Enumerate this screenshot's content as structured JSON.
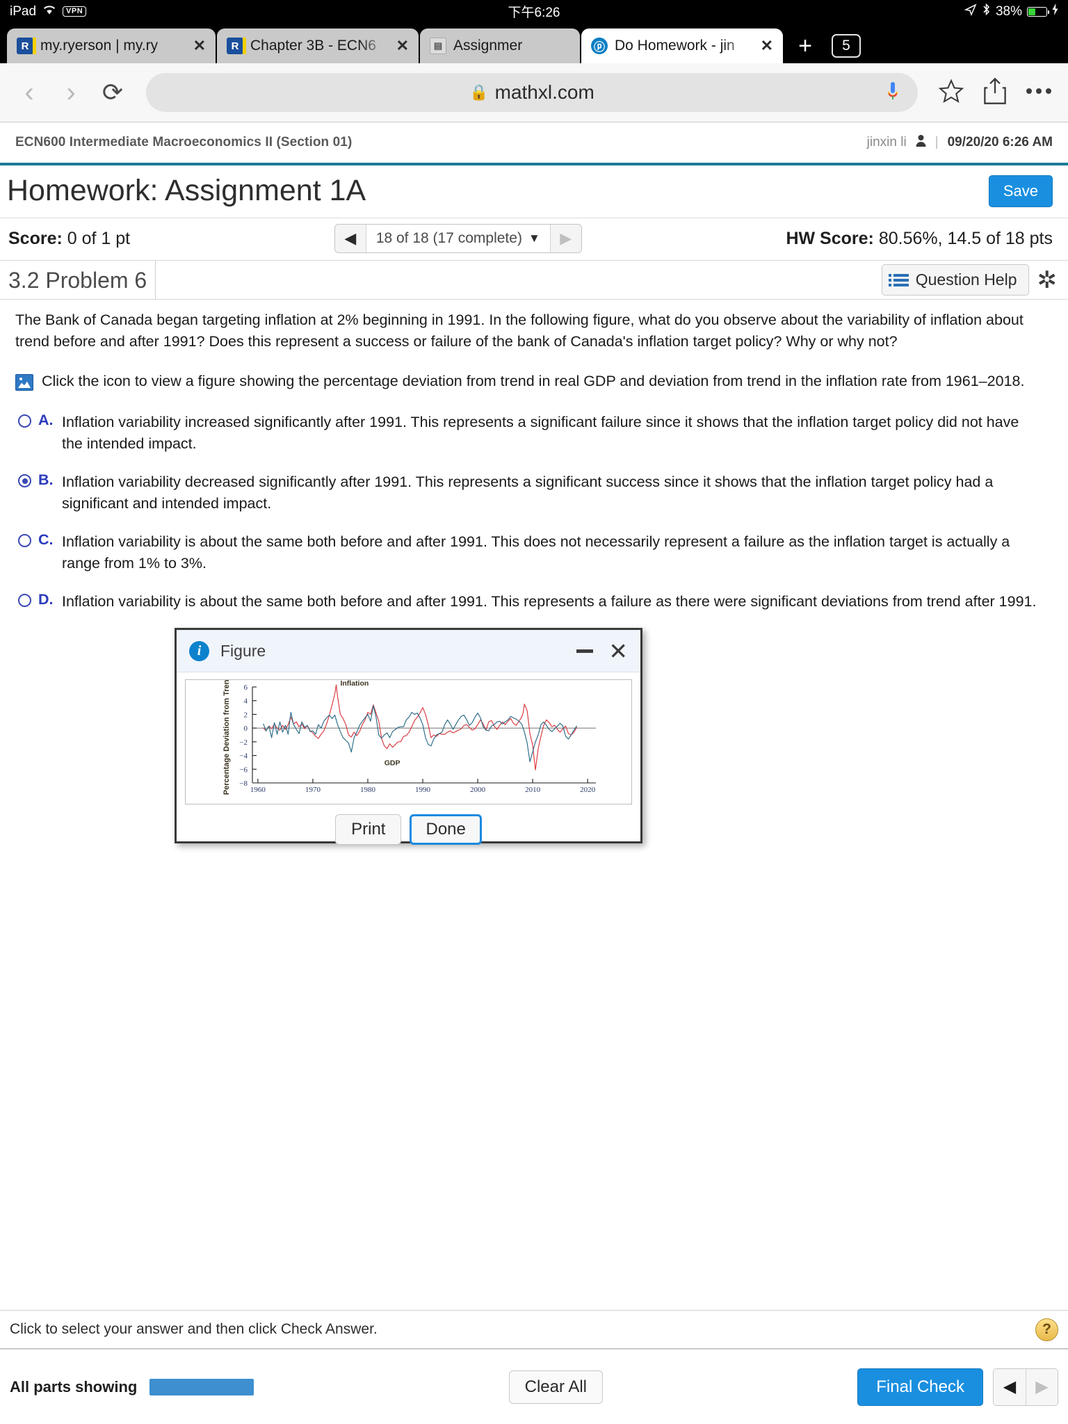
{
  "status_bar": {
    "device": "iPad",
    "wifi_icon": "wifi-icon",
    "vpn_label": "VPN",
    "time": "下午6:26",
    "location_icon": "location-arrow-icon",
    "bluetooth_icon": "bluetooth-icon",
    "battery_percent": "38%",
    "charging_icon": "lightning-bolt-icon"
  },
  "browser": {
    "tabs": [
      {
        "title": "my.ryerson | my.ry",
        "favicon": "pearson-r-icon",
        "active": false
      },
      {
        "title": "Chapter 3B - ECN6",
        "favicon": "pearson-r-icon",
        "active": false
      },
      {
        "title": "Assignmer",
        "favicon": "document-icon",
        "active": false
      },
      {
        "title": "Do Homework - jin",
        "favicon": "pearson-p-icon",
        "active": true
      }
    ],
    "new_tab_label": "+",
    "tab_count": "5",
    "back_icon": "chevron-left-icon",
    "forward_icon": "chevron-right-icon",
    "reload_icon": "reload-icon",
    "lock_icon": "lock-icon",
    "url": "mathxl.com",
    "mic_icon": "google-mic-icon",
    "bookmark_icon": "star-icon",
    "share_icon": "share-icon",
    "more_icon": "ellipsis-icon"
  },
  "mathxl_header": {
    "course": "ECN600 Intermediate Macroeconomics II (Section 01)",
    "user": "jinxin li",
    "user_icon": "person-icon",
    "separator": "|",
    "datetime": "09/20/20 6:26 AM"
  },
  "title_row": {
    "title": "Homework: Assignment 1A",
    "save_label": "Save"
  },
  "score_row": {
    "score_label": "Score:",
    "score_value": "0 of 1 pt",
    "prev_icon": "prev-arrow-icon",
    "next_icon": "next-arrow-icon",
    "pager_text": "18 of 18 (17 complete)",
    "pager_caret": "▼",
    "hw_label": "HW Score:",
    "hw_value": "80.56%, 14.5 of 18 pts"
  },
  "problem_bar": {
    "problem_label": "3.2 Problem 6",
    "question_help_label": "Question Help",
    "question_help_icon": "list-icon",
    "gear_icon": "gear-icon"
  },
  "question": {
    "prompt": "The Bank of Canada began targeting inflation at 2% beginning in 1991. In the following figure, what do you observe about the variability of inflation about trend before and after 1991? Does this represent a success or failure of the bank of Canada's inflation target policy? Why or why not?",
    "figure_link_icon": "image-icon",
    "figure_link_text": "Click the icon to view a figure showing the percentage deviation from trend in real GDP and deviation from trend in the inflation rate from 1961–2018.",
    "options": [
      {
        "letter": "A.",
        "selected": false,
        "text": "Inflation variability increased significantly after 1991. This represents a significant failure since it shows that the inflation target policy did not have the intended impact."
      },
      {
        "letter": "B.",
        "selected": true,
        "text": "Inflation variability decreased significantly after 1991. This represents a significant success since it shows that the inflation target policy had a significant and intended impact."
      },
      {
        "letter": "C.",
        "selected": false,
        "text": "Inflation variability is about the same both before and after 1991. This does not necessarily represent a failure as the inflation target is actually a range from 1% to 3%."
      },
      {
        "letter": "D.",
        "selected": false,
        "text": "Inflation variability is about the same both before and after 1991. This represents a failure as there were significant deviations from trend after 1991."
      }
    ]
  },
  "dialog": {
    "info_icon": "info-icon",
    "title": "Figure",
    "minimize_icon": "minimize-icon",
    "close_icon": "close-icon",
    "print_label": "Print",
    "done_label": "Done"
  },
  "chart_data": {
    "type": "line",
    "title": "",
    "xlabel": "",
    "ylabel": "Percentage Deviation from Trend",
    "xlim": [
      1961,
      2018
    ],
    "ylim": [
      -8,
      6
    ],
    "yticks": [
      -8,
      -6,
      -4,
      -2,
      0,
      2,
      4,
      6
    ],
    "xticks": [
      1960,
      1970,
      1980,
      1990,
      2000,
      2010,
      2020
    ],
    "grid": false,
    "legend_position": "inline-annotations",
    "annotations": [
      {
        "label": "Inflation",
        "x": 1975,
        "y": 6.2
      },
      {
        "label": "GDP",
        "x": 1983,
        "y": -5.4
      }
    ],
    "series": [
      {
        "name": "Inflation",
        "color": "#d8383f",
        "x": [
          1961,
          1961.5,
          1962,
          1962.5,
          1963,
          1963.5,
          1964,
          1964.5,
          1965,
          1965.5,
          1966,
          1966.5,
          1967,
          1967.5,
          1968,
          1968.5,
          1969,
          1969.5,
          1970,
          1970.5,
          1971,
          1971.5,
          1972,
          1972.5,
          1973,
          1973.5,
          1974,
          1974.25,
          1974.5,
          1975,
          1975.5,
          1976,
          1976.5,
          1977,
          1977.5,
          1978,
          1978.5,
          1979,
          1979.5,
          1980,
          1980.5,
          1981,
          1981.5,
          1982,
          1982.5,
          1983,
          1983.5,
          1984,
          1984.5,
          1985,
          1985.5,
          1986,
          1986.5,
          1987,
          1987.5,
          1988,
          1988.5,
          1989,
          1989.5,
          1990,
          1990.5,
          1991,
          1991.5,
          1992,
          1992.5,
          1993,
          1993.5,
          1994,
          1994.5,
          1995,
          1995.5,
          1996,
          1996.5,
          1997,
          1997.5,
          1998,
          1998.5,
          1999,
          1999.5,
          2000,
          2000.5,
          2001,
          2001.5,
          2002,
          2002.5,
          2003,
          2003.5,
          2004,
          2004.5,
          2005,
          2005.5,
          2006,
          2006.5,
          2007,
          2007.5,
          2008,
          2008.25,
          2008.5,
          2009,
          2009.5,
          2010,
          2010.5,
          2011,
          2011.5,
          2012,
          2012.5,
          2013,
          2013.5,
          2014,
          2014.5,
          2015,
          2015.5,
          2016,
          2016.5,
          2017,
          2017.5,
          2018
        ],
        "y": [
          0.0,
          -0.4,
          0.3,
          -0.1,
          0.6,
          0.0,
          -0.3,
          0.4,
          -0.2,
          0.5,
          1.6,
          0.6,
          0.9,
          0.2,
          0.6,
          -0.1,
          0.4,
          -0.4,
          -0.7,
          -1.2,
          -1.5,
          -0.9,
          -0.4,
          0.6,
          1.9,
          3.4,
          5.0,
          6.3,
          4.6,
          2.0,
          1.4,
          0.5,
          -1.0,
          -1.3,
          -0.6,
          -1.1,
          -0.5,
          0.5,
          1.2,
          2.3,
          2.0,
          3.4,
          2.2,
          1.0,
          -1.5,
          -2.6,
          -3.0,
          -2.3,
          -2.8,
          -2.4,
          -2.0,
          -2.0,
          -1.2,
          -1.1,
          -0.6,
          0.2,
          1.1,
          1.6,
          2.2,
          3.0,
          2.0,
          0.5,
          -1.4,
          -1.0,
          -1.2,
          -0.8,
          -0.9,
          -0.9,
          -0.6,
          -0.4,
          -0.7,
          -0.5,
          -0.3,
          -0.1,
          0.4,
          0.5,
          0.1,
          -0.3,
          -0.1,
          0.5,
          1.2,
          0.6,
          -0.3,
          0.9,
          1.1,
          0.3,
          -0.2,
          0.4,
          0.9,
          0.5,
          1.0,
          1.4,
          0.7,
          0.4,
          1.0,
          1.6,
          2.2,
          3.5,
          2.5,
          -0.8,
          -2.5,
          -6.1,
          -3.0,
          -1.2,
          0.4,
          1.2,
          0.8,
          0.2,
          0.4,
          -0.2,
          -0.6,
          -0.1,
          0.3,
          -0.8,
          -1.0,
          -0.6,
          0.1,
          0.4,
          0.2
        ]
      },
      {
        "name": "GDP",
        "color": "#2a6b86",
        "x": [
          1961,
          1961.5,
          1962,
          1962.5,
          1963,
          1963.5,
          1964,
          1964.5,
          1965,
          1965.5,
          1966,
          1966.5,
          1967,
          1967.5,
          1968,
          1968.5,
          1969,
          1969.5,
          1970,
          1970.5,
          1971,
          1971.5,
          1972,
          1972.5,
          1973,
          1973.5,
          1974,
          1974.5,
          1975,
          1975.5,
          1976,
          1976.5,
          1977,
          1977.5,
          1978,
          1978.5,
          1979,
          1979.5,
          1980,
          1980.5,
          1981,
          1981.5,
          1982,
          1982.5,
          1983,
          1983.5,
          1984,
          1984.5,
          1985,
          1985.5,
          1986,
          1986.5,
          1987,
          1987.5,
          1988,
          1988.5,
          1989,
          1989.5,
          1990,
          1990.5,
          1991,
          1991.5,
          1992,
          1992.5,
          1993,
          1993.5,
          1994,
          1994.5,
          1995,
          1995.5,
          1996,
          1996.5,
          1997,
          1997.5,
          1998,
          1998.5,
          1999,
          1999.5,
          2000,
          2000.5,
          2001,
          2001.5,
          2002,
          2002.5,
          2003,
          2003.5,
          2004,
          2004.5,
          2005,
          2005.5,
          2006,
          2006.5,
          2007,
          2007.5,
          2008,
          2008.5,
          2009,
          2009.25,
          2009.5,
          2010,
          2010.5,
          2011,
          2011.5,
          2012,
          2012.5,
          2013,
          2013.5,
          2014,
          2014.5,
          2015,
          2015.5,
          2016,
          2016.5,
          2017,
          2017.5,
          2018
        ],
        "y": [
          0.6,
          -0.4,
          0.3,
          -1.4,
          0.8,
          -0.9,
          0.9,
          -0.6,
          0.4,
          -0.9,
          2.3,
          0.5,
          -0.2,
          -0.8,
          0.9,
          0.1,
          0.4,
          -0.5,
          -0.4,
          -0.9,
          0.5,
          0.0,
          1.0,
          1.5,
          1.9,
          1.4,
          1.9,
          0.5,
          -0.5,
          -1.4,
          -1.8,
          -2.2,
          -3.5,
          -1.4,
          -0.6,
          0.4,
          1.0,
          1.5,
          2.0,
          1.0,
          3.3,
          1.6,
          -1.0,
          -1.5,
          -1.0,
          -0.7,
          -1.4,
          -0.5,
          -0.2,
          0.1,
          0.2,
          0.2,
          1.2,
          1.6,
          2.3,
          2.0,
          2.2,
          1.5,
          0.5,
          -1.4,
          -2.4,
          -2.6,
          -1.6,
          -1.0,
          -0.8,
          -0.6,
          0.5,
          1.2,
          0.6,
          -0.2,
          0.5,
          1.2,
          1.7,
          1.9,
          1.2,
          0.4,
          0.8,
          1.6,
          2.2,
          1.5,
          0.2,
          -0.3,
          -0.4,
          0.3,
          0.5,
          0.9,
          1.0,
          0.6,
          0.9,
          1.2,
          1.7,
          1.5,
          1.3,
          1.0,
          0.6,
          -0.6,
          -2.2,
          -3.6,
          -4.9,
          -3.5,
          -2.0,
          -1.0,
          0.5,
          0.9,
          0.4,
          -0.2,
          -0.5,
          -0.1,
          0.3,
          0.7,
          0.3,
          -1.2,
          -1.6,
          -1.0,
          -0.3,
          0.3,
          0.4
        ]
      }
    ]
  },
  "hint_bar": {
    "text": "Click to select your answer and then click Check Answer.",
    "help_icon": "question-mark-icon"
  },
  "footer": {
    "parts_label": "All parts showing",
    "clear_label": "Clear All",
    "final_check_label": "Final Check",
    "prev_icon": "prev-arrow-icon",
    "next_icon": "next-arrow-icon"
  }
}
